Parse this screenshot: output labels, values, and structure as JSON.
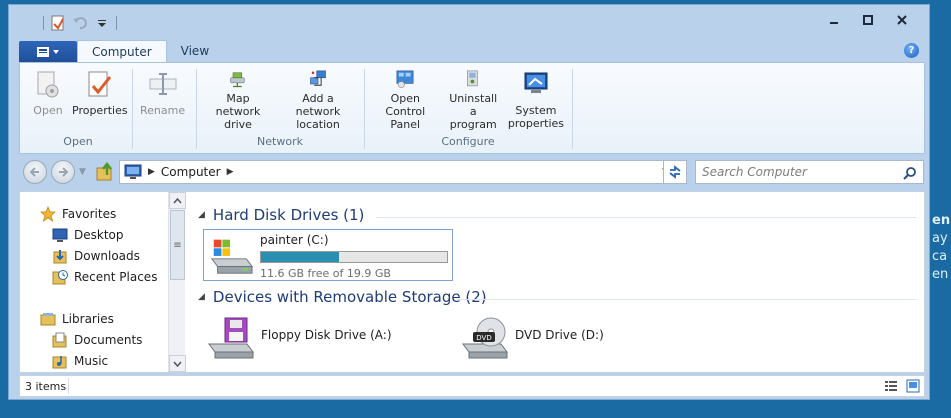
{
  "desktop_peek": [
    "en",
    "ay",
    "ca",
    "en"
  ],
  "ribbon": {
    "tabs": [
      "Computer",
      "View"
    ],
    "groups": [
      {
        "label": "Open",
        "buttons": [
          {
            "label": "Open"
          },
          {
            "label": "Properties"
          }
        ]
      },
      {
        "label": "",
        "buttons": [
          {
            "label": "Rename"
          }
        ]
      },
      {
        "label": "Network",
        "buttons": [
          {
            "label": "Map network\ndrive"
          },
          {
            "label": "Add a network\nlocation"
          }
        ]
      },
      {
        "label": "Configure",
        "buttons": [
          {
            "label": "Open Control\nPanel"
          },
          {
            "label": "Uninstall a\nprogram"
          },
          {
            "label": "System\nproperties"
          }
        ]
      }
    ],
    "help": "?"
  },
  "address": {
    "crumb": "Computer"
  },
  "search": {
    "placeholder": "Search Computer"
  },
  "nav_pane": {
    "favorites": "Favorites",
    "fav_items": [
      "Desktop",
      "Downloads",
      "Recent Places"
    ],
    "libraries": "Libraries",
    "lib_items": [
      "Documents",
      "Music"
    ]
  },
  "sections": {
    "hdd": "Hard Disk Drives (1)",
    "removable": "Devices with Removable Storage (2)"
  },
  "drives": {
    "c": {
      "name": "painter (C:)",
      "free_text": "11.6 GB free of 19.9 GB",
      "used_fraction": 0.417
    },
    "floppy": {
      "name": "Floppy Disk Drive (A:)"
    },
    "dvd": {
      "name": "DVD Drive (D:)",
      "badge": "DVD"
    }
  },
  "status": {
    "count": "3 items"
  }
}
